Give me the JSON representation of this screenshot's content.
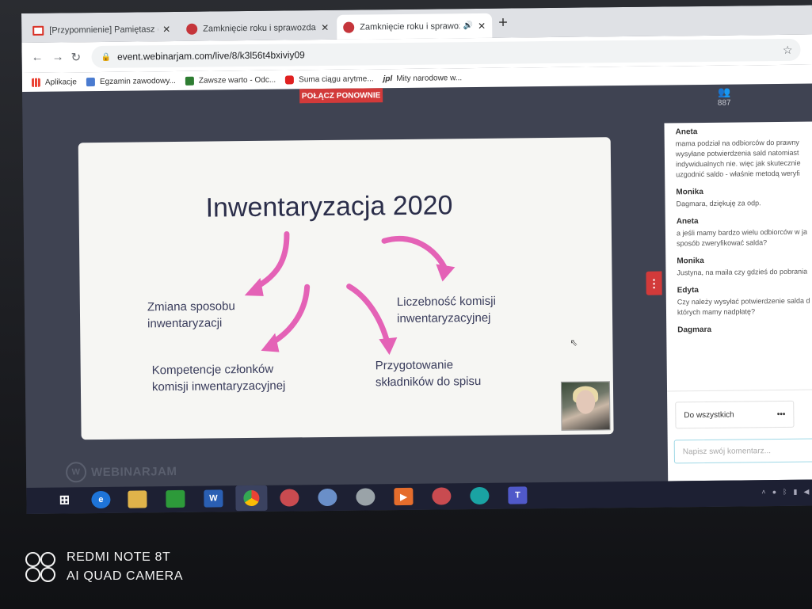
{
  "tabs": [
    {
      "title": "[Przypomnienie] Pamiętasz o zb",
      "favicon_color": "#d93025",
      "favicon": "gmail-icon"
    },
    {
      "title": "Zamknięcie roku i sprawozdanie",
      "favicon_color": "#c5353b",
      "favicon": "webinar-icon"
    },
    {
      "title": "Zamknięcie roku i sprawozda",
      "favicon_color": "#c5353b",
      "favicon": "webinar-icon",
      "active": true
    }
  ],
  "address": {
    "url": "event.webinarjam.com/live/8/k3l56t4bxiviy09"
  },
  "bookmarks": [
    {
      "label": "Aplikacje",
      "color": "#ea4335"
    },
    {
      "label": "Egzamin zawodowy...",
      "color": "#4a7bd0"
    },
    {
      "label": "Zawsze warto - Odc...",
      "color": "#2e7d32"
    },
    {
      "label": "Suma ciągu arytme...",
      "color": "#e02020"
    },
    {
      "label": "Mity narodowe w...",
      "color": "#2c2c2c",
      "prefix": "jpl"
    }
  ],
  "webinar": {
    "reconnect_label": "POŁĄCZ PONOWNIE",
    "attendee_count": "887",
    "accent": "#d23a3a",
    "logo_text": "WEBINARJAM"
  },
  "slide": {
    "title": "Inwentaryzacja 2020",
    "items": [
      {
        "line1": "Zmiana sposobu",
        "line2": "inwentaryzacji"
      },
      {
        "line1": "Liczebność komisji",
        "line2": "inwentaryzacyjnej"
      },
      {
        "line1": "Kompetencje członków",
        "line2": "komisji inwentaryzacyjnej"
      },
      {
        "line1": "Przygotowanie",
        "line2": "składników do spisu"
      }
    ],
    "arrow_color": "#e462b6"
  },
  "chat": {
    "messages": [
      {
        "author": "Aneta",
        "text": "mama podział na odbiorców do prawny wysyłane potwierdzenia sald natomiast indywidualnych nie. więc jak skutecznie uzgodnić saldo - właśnie metodą weryfi"
      },
      {
        "author": "Monika",
        "text": "Dagmara, dziękuję za odp."
      },
      {
        "author": "Aneta",
        "text": "a jeśli mamy bardzo wielu odbiorców w ja sposób zweryfikować salda?"
      },
      {
        "author": "Monika",
        "text": "Justyna, na maila czy gdzieś do pobrania"
      },
      {
        "author": "Edyta",
        "text": "Czy należy wysyłać potwierdzenie salda d których mamy nadpłatę?"
      },
      {
        "author": "Dagmara",
        "text": ""
      }
    ],
    "audience_select": "Do wszystkich",
    "comment_placeholder": "Napisz swój komentarz..."
  },
  "taskbar": {
    "apps": [
      "start-icon",
      "edge-icon",
      "file-explorer-icon",
      "store-icon",
      "word-icon",
      "chrome-icon",
      "gt-app-icon",
      "gt-app-icon",
      "gt-app-icon",
      "video-icon",
      "gt-app-icon",
      "edge-new-icon",
      "teams-icon"
    ]
  },
  "watermark": {
    "line1": "REDMI NOTE 8T",
    "line2": "AI QUAD CAMERA"
  }
}
